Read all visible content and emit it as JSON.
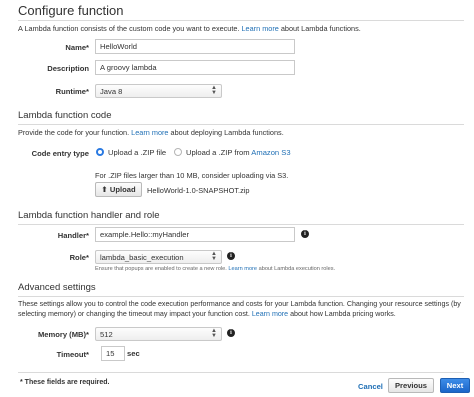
{
  "colors": {
    "link": "#1f6fb5",
    "primary_button": "#1a66c9",
    "radio_selected": "#2a7ae2"
  },
  "configure": {
    "title": "Configure function",
    "desc_prefix": "A Lambda function consists of the custom code you want to execute.",
    "desc_link": "Learn more",
    "desc_suffix": "about Lambda functions.",
    "name_label": "Name*",
    "name_value": "HelloWorld",
    "description_label": "Description",
    "description_value": "A groovy lambda",
    "runtime_label": "Runtime*",
    "runtime_value": "Java 8"
  },
  "code": {
    "title": "Lambda function code",
    "desc_prefix": "Provide the code for your function.",
    "desc_link": "Learn more",
    "desc_suffix": "about deploying Lambda functions.",
    "entry_label": "Code entry type",
    "option_zip": "Upload a .ZIP file",
    "option_s3_prefix": "Upload a .ZIP from",
    "option_s3_link": "Amazon S3",
    "note": "For .ZIP files larger than 10 MB, consider uploading via S3.",
    "upload_label": "Upload",
    "file_name": "HelloWorld-1.0-SNAPSHOT.zip"
  },
  "handler_role": {
    "title": "Lambda function handler and role",
    "handler_label": "Handler*",
    "handler_value": "example.Hello::myHandler",
    "role_label": "Role*",
    "role_value": "lambda_basic_execution",
    "role_note_prefix": "Ensure that popups are enabled to create a new role.",
    "role_note_link": "Learn more",
    "role_note_suffix": "about Lambda execution roles."
  },
  "advanced": {
    "title": "Advanced settings",
    "desc_line1": "These settings allow you to control the code execution performance and costs for your Lambda function. Changing your resource settings (by",
    "desc_line2_prefix": "selecting memory) or changing the timeout may impact your function cost.",
    "desc_link": "Learn more",
    "desc_suffix": "about how Lambda pricing works.",
    "memory_label": "Memory (MB)*",
    "memory_value": "512",
    "timeout_label": "Timeout*",
    "timeout_value": "15",
    "timeout_unit": "sec"
  },
  "footer": {
    "required_note": "* These fields are required.",
    "cancel": "Cancel",
    "previous": "Previous",
    "next": "Next"
  },
  "icons": {
    "info": "info-icon",
    "upload": "upload-icon",
    "select_arrows": "select-arrows-icon"
  }
}
